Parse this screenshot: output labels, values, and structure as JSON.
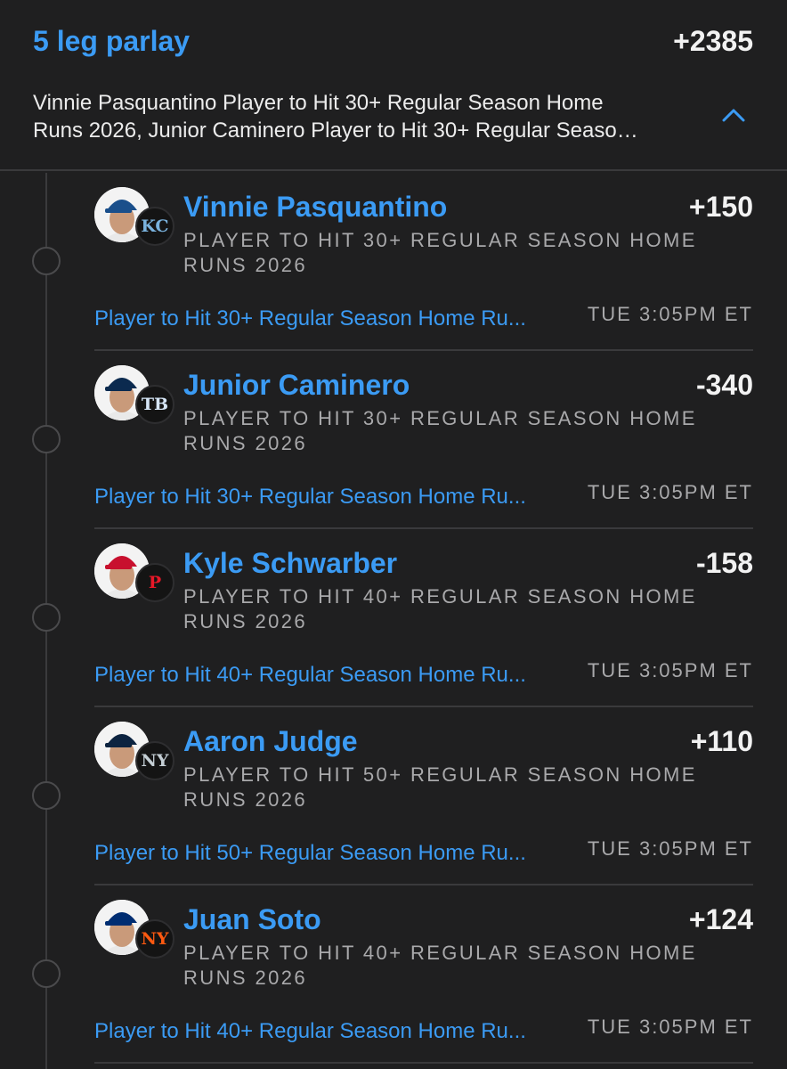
{
  "parlay": {
    "title": "5 leg parlay",
    "odds": "+2385",
    "summary_line1": "Vinnie Pasquantino Player to Hit 30+ Regular Season Home",
    "summary_line2": "Runs 2026, Junior Caminero Player to Hit 30+ Regular Seaso…",
    "collapse_icon": "chevron-up-icon",
    "accent_color": "#3b9bf4"
  },
  "legs": [
    {
      "player": "Vinnie Pasquantino",
      "odds": "+150",
      "market": "PLAYER TO HIT 30+ REGULAR SEASON HOME RUNS 2026",
      "market_link": "Player to Hit 30+ Regular Season Home Ru...",
      "time": "TUE 3:05PM ET",
      "team_logo": "KC",
      "team_color": "#7ab2dd",
      "cap_color": "#1a4f8b"
    },
    {
      "player": "Junior Caminero",
      "odds": "-340",
      "market": "PLAYER TO HIT 30+ REGULAR SEASON HOME RUNS 2026",
      "market_link": "Player to Hit 30+ Regular Season Home Ru...",
      "time": "TUE 3:05PM ET",
      "team_logo": "TB",
      "team_color": "#d6e6f7",
      "cap_color": "#0b2a4f"
    },
    {
      "player": "Kyle Schwarber",
      "odds": "-158",
      "market": "PLAYER TO HIT 40+ REGULAR SEASON HOME RUNS 2026",
      "market_link": "Player to Hit 40+ Regular Season Home Ru...",
      "time": "TUE 3:05PM ET",
      "team_logo": "P",
      "team_color": "#e81828",
      "cap_color": "#c8102e"
    },
    {
      "player": "Aaron Judge",
      "odds": "+110",
      "market": "PLAYER TO HIT 50+ REGULAR SEASON HOME RUNS 2026",
      "market_link": "Player to Hit 50+ Regular Season Home Ru...",
      "time": "TUE 3:05PM ET",
      "team_logo": "NY",
      "team_color": "#c4ced4",
      "cap_color": "#0c2340"
    },
    {
      "player": "Juan Soto",
      "odds": "+124",
      "market": "PLAYER TO HIT 40+ REGULAR SEASON HOME RUNS 2026",
      "market_link": "Player to Hit 40+ Regular Season Home Ru...",
      "time": "TUE 3:05PM ET",
      "team_logo": "NY",
      "team_color": "#ff5910",
      "cap_color": "#002d72"
    }
  ]
}
